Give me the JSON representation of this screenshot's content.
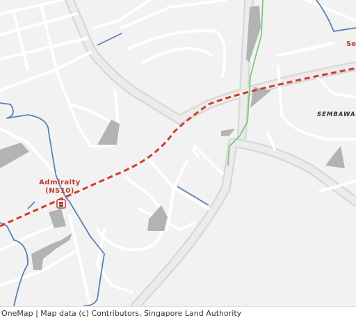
{
  "map": {
    "colors": {
      "background": "#f2f2f2",
      "road": "#ffffff",
      "major_road_casing": "#d9d9d9",
      "building": "#b3b3b3",
      "mrt_line": "#d33a2c",
      "boundary": "#5b7fb5",
      "path": "#7ac97a",
      "station_label": "#c0392b"
    },
    "labels": {
      "station": {
        "name": "Admiralty",
        "code": "(NS10)"
      },
      "area": "SEMBAWAN",
      "station_right": "Se"
    },
    "icons": [
      "mrt-station-icon"
    ]
  },
  "attribution": "OneMap | Map data (c) Contributors, Singapore Land Authority"
}
